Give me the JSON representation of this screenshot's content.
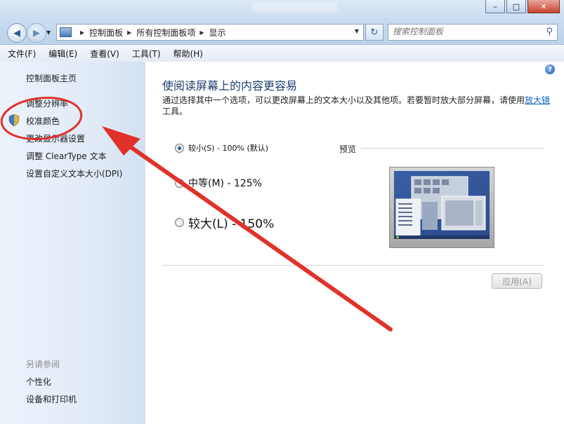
{
  "window": {
    "caption_min": "–",
    "caption_max": "□",
    "caption_close": "✕"
  },
  "address": {
    "breadcrumbs": [
      "控制面板",
      "所有控制面板项",
      "显示"
    ],
    "search_placeholder": "搜索控制面板"
  },
  "menu": [
    "文件(F)",
    "编辑(E)",
    "查看(V)",
    "工具(T)",
    "帮助(H)"
  ],
  "sidebar": {
    "home": "控制面板主页",
    "items": [
      "调整分辨率",
      "校准颜色",
      "更改显示器设置",
      "调整 ClearType 文本",
      "设置自定义文本大小(DPI)"
    ],
    "see_also_heading": "另请参阅",
    "see_also": [
      "个性化",
      "设备和打印机"
    ]
  },
  "main": {
    "title": "使阅读屏幕上的内容更容易",
    "description_prefix": "通过选择其中一个选项，可以更改屏幕上的文本大小以及其他项。若要暂时放大部分屏幕，请使用",
    "description_link": "放大镜",
    "description_suffix": "工具。",
    "options": [
      {
        "label": "较小(S) - 100% (默认)",
        "selected": true
      },
      {
        "label": "中等(M) - 125%",
        "selected": false
      },
      {
        "label": "较大(L) - 150%",
        "selected": false
      }
    ],
    "preview_label": "预览",
    "apply_button": "应用(A)"
  },
  "colors": {
    "annotation_red": "#e0322a",
    "link_blue": "#0b66c2",
    "title_blue": "#1e3f6f"
  }
}
